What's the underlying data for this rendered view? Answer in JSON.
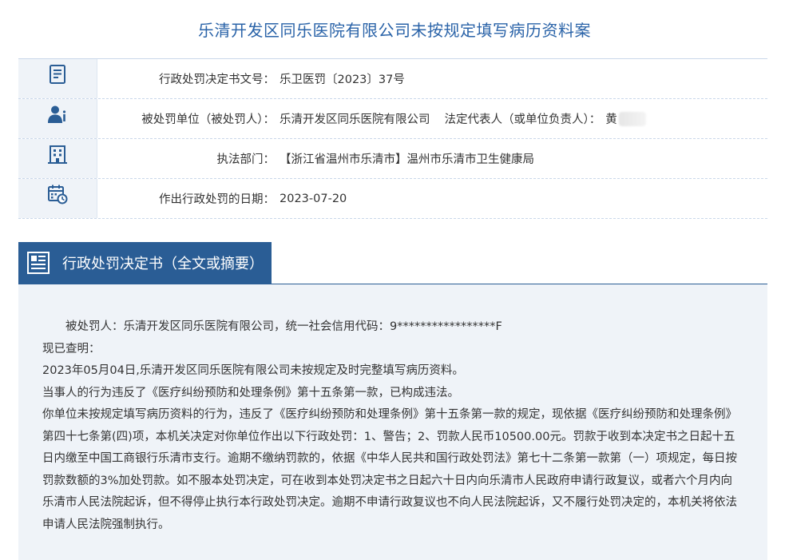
{
  "page": {
    "title": "乐清开发区同乐医院有限公司未按规定填写病历资料案"
  },
  "info_rows": [
    {
      "icon": "document-list-icon",
      "label": "行政处罚决定书文号：",
      "value": "乐卫医罚〔2023〕37号"
    },
    {
      "icon": "person-info-icon",
      "label": "被处罚单位（被处罚人）：",
      "value": "乐清开发区同乐医院有限公司",
      "rep_label": "法定代表人（或单位负责人）：",
      "rep_value": "黄"
    },
    {
      "icon": "building-icon",
      "label": "执法部门：",
      "value": "【浙江省温州市乐清市】温州市乐清市卫生健康局"
    },
    {
      "icon": "calendar-clock-icon",
      "label": "作出行政处罚的日期：",
      "value": "2023-07-20"
    }
  ],
  "section": {
    "icon": "document-icon",
    "title": "行政处罚决定书（全文或摘要）"
  },
  "content": {
    "p1": "被处罚人：乐清开发区同乐医院有限公司，统一社会信用代码：9*****************F",
    "p2": "现已查明：",
    "p3": "2023年05月04日,乐清开发区同乐医院有限公司未按规定及时完整填写病历资料。",
    "p4": "当事人的行为违反了《医疗纠纷预防和处理条例》第十五条第一款，已构成违法。",
    "p5": "你单位未按规定填写病历资料的行为，违反了《医疗纠纷预防和处理条例》第十五条第一款的规定，现依据《医疗纠纷预防和处理条例》第四十七条第(四)项，本机关决定对你单位作出以下行政处罚：1、警告；2、罚款人民币10500.00元。罚款于收到本决定书之日起十五日内缴至中国工商银行乐清市支行。逾期不缴纳罚款的，依据《中华人民共和国行政处罚法》第七十二条第一款第（一）项规定，每日按罚款数额的3%加处罚款。如不服本处罚决定，可在收到本处罚决定书之日起六十日内向乐清市人民政府申请行政复议，或者六个月内向乐清市人民法院起诉，但不得停止执行本行政处罚决定。逾期不申请行政复议也不向人民法院起诉，又不履行处罚决定的，本机关将依法申请人民法院强制执行。"
  },
  "colors": {
    "title": "#2a63a8",
    "accent": "#2a5d95",
    "panel_bg": "#eff3f8"
  }
}
